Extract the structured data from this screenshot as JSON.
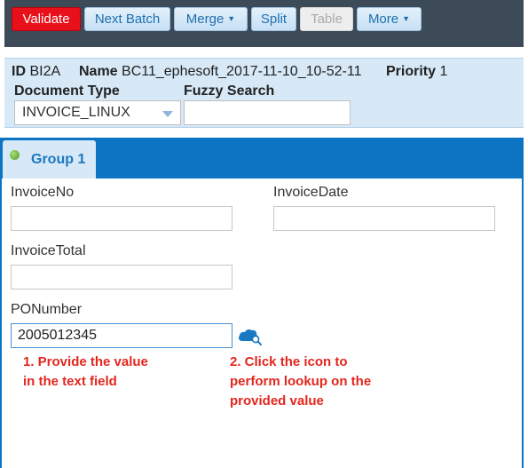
{
  "toolbar": {
    "validate_label": "Validate",
    "next_batch_label": "Next Batch",
    "merge_label": "Merge",
    "split_label": "Split",
    "table_label": "Table",
    "more_label": "More",
    "dropdown_caret": "▼"
  },
  "info": {
    "id_label": "ID",
    "id_value": "BI2A",
    "name_label": "Name",
    "name_value": "BC11_ephesoft_2017-11-10_10-52-11",
    "priority_label": "Priority",
    "priority_value": "1",
    "document_type_label": "Document Type",
    "document_type_value": "INVOICE_LINUX",
    "fuzzy_search_label": "Fuzzy Search",
    "fuzzy_search_value": ""
  },
  "group_tab": {
    "label": "Group 1",
    "status_color": "#4e9a1e"
  },
  "fields": {
    "invoice_no": {
      "label": "InvoiceNo",
      "value": ""
    },
    "invoice_date": {
      "label": "InvoiceDate",
      "value": ""
    },
    "invoice_total": {
      "label": "InvoiceTotal",
      "value": ""
    },
    "po_number": {
      "label": "PONumber",
      "value": "2005012345"
    }
  },
  "lookup_icon": "cloud-search-icon",
  "annotations": {
    "note1_line1": "1. Provide the value",
    "note1_line2": "in the text field",
    "note2_line1": "2. Click the icon to",
    "note2_line2": "perform lookup on the",
    "note2_line3": "provided value"
  },
  "colors": {
    "toolbar_bg": "#3d4a58",
    "validate_red": "#e8101a",
    "accent_blue": "#0d74c4",
    "info_bg": "#d7e9f7",
    "annotation_red": "#e3261d"
  }
}
